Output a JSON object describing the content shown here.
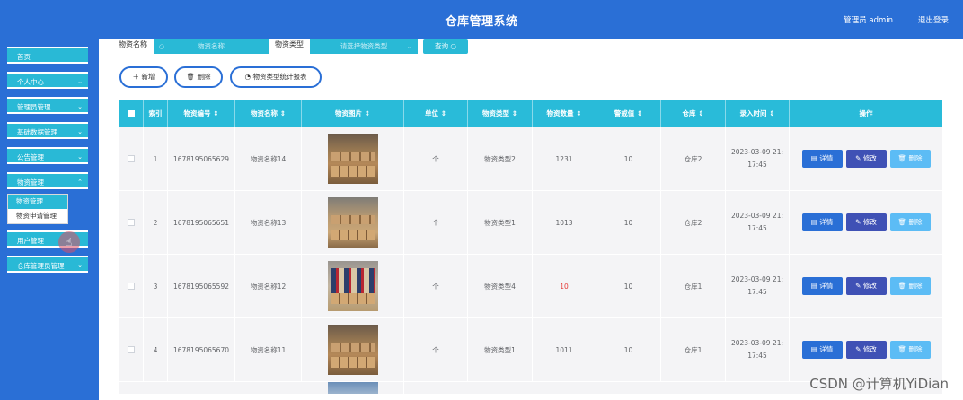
{
  "header": {
    "title": "仓库管理系统",
    "admin": "管理员 admin",
    "logout": "退出登录"
  },
  "sidebar": {
    "items": [
      {
        "label": "首页",
        "has_chevron": false
      },
      {
        "label": "个人中心",
        "has_chevron": true
      },
      {
        "label": "管理员管理",
        "has_chevron": true
      },
      {
        "label": "基础数据管理",
        "has_chevron": true
      },
      {
        "label": "公告管理",
        "has_chevron": true
      },
      {
        "label": "物资管理",
        "has_chevron": true
      },
      {
        "label": "用户管理",
        "has_chevron": false
      },
      {
        "label": "仓库管理员管理",
        "has_chevron": true
      }
    ],
    "submenu": [
      "物资管理",
      "物资申请管理"
    ]
  },
  "search": {
    "name_label": "物资名称",
    "name_placeholder": "物资名称",
    "type_label": "物资类型",
    "type_placeholder": "请选择物资类型",
    "button": "查询"
  },
  "actions": {
    "add": "新增",
    "delete": "删除",
    "report": "物资类型统计报表"
  },
  "table": {
    "headers": [
      "索引",
      "物资编号",
      "物资名称",
      "物资图片",
      "单位",
      "物资类型",
      "物资数量",
      "警戒值",
      "仓库",
      "录入时间",
      "操作"
    ],
    "rows": [
      {
        "index": "1",
        "code": "1678195065629",
        "name": "物资名称14",
        "unit": "个",
        "type": "物资类型2",
        "qty": "1231",
        "qty_alert": false,
        "warn": "10",
        "warehouse": "仓库2",
        "time1": "2023-03-09 21:",
        "time2": "17:45"
      },
      {
        "index": "2",
        "code": "1678195065651",
        "name": "物资名称13",
        "unit": "个",
        "type": "物资类型1",
        "qty": "1013",
        "qty_alert": false,
        "warn": "10",
        "warehouse": "仓库2",
        "time1": "2023-03-09 21:",
        "time2": "17:45"
      },
      {
        "index": "3",
        "code": "1678195065592",
        "name": "物资名称12",
        "unit": "个",
        "type": "物资类型4",
        "qty": "10",
        "qty_alert": true,
        "warn": "10",
        "warehouse": "仓库1",
        "time1": "2023-03-09 21:",
        "time2": "17:45"
      },
      {
        "index": "4",
        "code": "1678195065670",
        "name": "物资名称11",
        "unit": "个",
        "type": "物资类型1",
        "qty": "1011",
        "qty_alert": false,
        "warn": "10",
        "warehouse": "仓库1",
        "time1": "2023-03-09 21:",
        "time2": "17:45"
      }
    ],
    "op_labels": {
      "detail": "详情",
      "edit": "修改",
      "del": "删除"
    }
  },
  "watermark": "CSDN @计算机YiDian",
  "colors": {
    "header_bg": "#2a6fd6",
    "accent": "#29b9d6",
    "danger_value": "#e53935",
    "op_detail": "#2a6fd6",
    "op_edit": "#3f51b5",
    "op_delete": "#5cbcf5"
  }
}
